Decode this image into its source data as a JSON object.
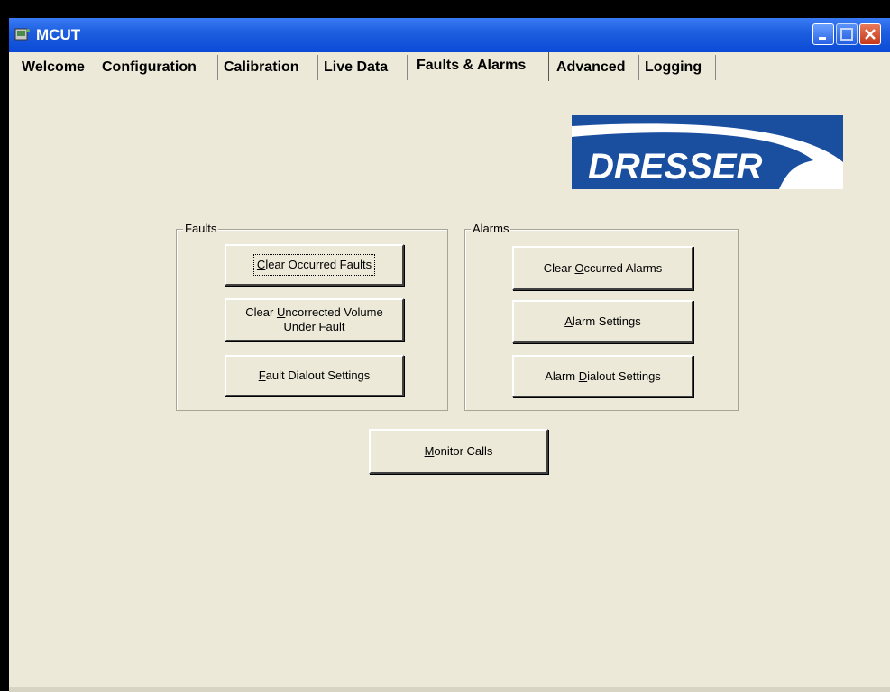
{
  "window": {
    "title": "MCUT"
  },
  "tabs": [
    {
      "label": "Welcome",
      "active": false
    },
    {
      "label": "Configuration",
      "active": false
    },
    {
      "label": "Calibration",
      "active": false
    },
    {
      "label": "Live Data",
      "active": false
    },
    {
      "label": "Faults & Alarms",
      "active": true
    },
    {
      "label": "Advanced",
      "active": false
    },
    {
      "label": "Logging",
      "active": false
    }
  ],
  "logo": {
    "text": "DRESSER",
    "brand_color": "#1a4fa0"
  },
  "faults": {
    "group_label": "Faults",
    "clear_occurred": {
      "pre": "",
      "mnemonic": "C",
      "post": "lear Occurred Faults"
    },
    "clear_uncorrected": {
      "pre": "Clear ",
      "mnemonic": "U",
      "post": "ncorrected Volume\nUnder Fault"
    },
    "dialout": {
      "pre": "",
      "mnemonic": "F",
      "post": "ault Dialout Settings"
    }
  },
  "alarms": {
    "group_label": "Alarms",
    "clear_occurred": {
      "pre": "Clear ",
      "mnemonic": "O",
      "post": "ccurred Alarms"
    },
    "settings": {
      "pre": "",
      "mnemonic": "A",
      "post": "larm Settings"
    },
    "dialout": {
      "pre": "Alarm ",
      "mnemonic": "D",
      "post": "ialout Settings"
    }
  },
  "monitor_calls": {
    "pre": "",
    "mnemonic": "M",
    "post": "onitor Calls"
  }
}
